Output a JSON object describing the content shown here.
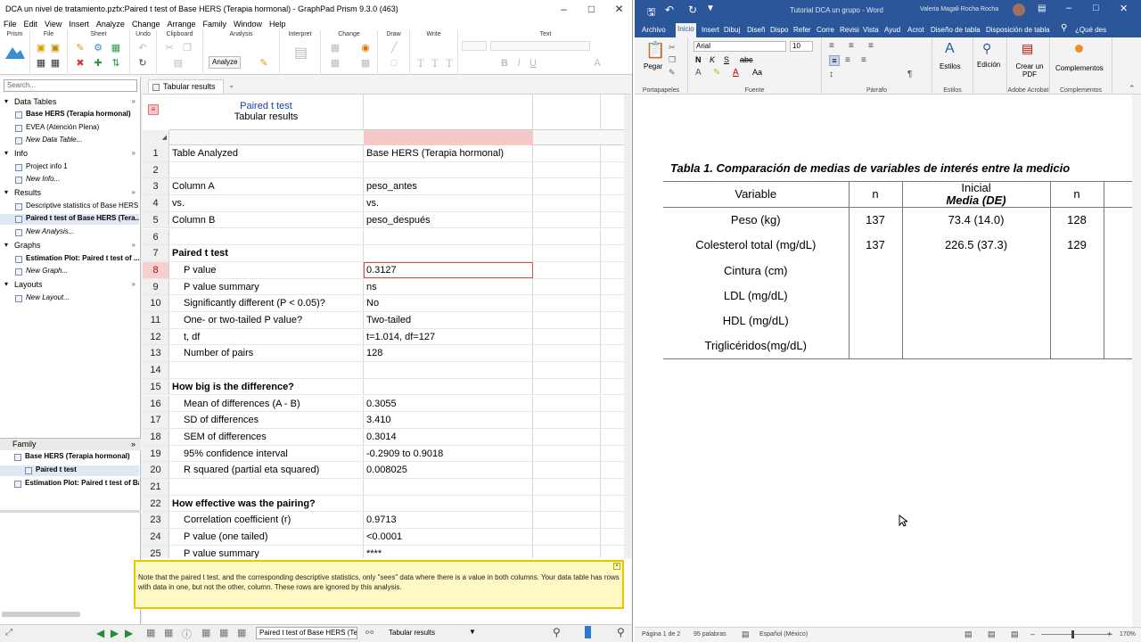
{
  "prism": {
    "window_title": "DCA un nivel de tratamiento.pzfx:Paired t test of Base HERS (Terapia hormonal) - GraphPad Prism 9.3.0 (463)",
    "menu": [
      "File",
      "Edit",
      "View",
      "Insert",
      "Analyze",
      "Change",
      "Arrange",
      "Family",
      "Window",
      "Help"
    ],
    "ribbon_groups": [
      "Prism",
      "File",
      "Sheet",
      "Undo",
      "Clipboard",
      "Analysis",
      "Interpret",
      "Change",
      "Draw",
      "Write",
      "Text"
    ],
    "analyze_button": "Analyze",
    "search_placeholder": "Search...",
    "navigator": {
      "data_tables": {
        "label": "Data Tables",
        "items": [
          "Base HERS (Terapia hormonal)",
          "EVEA (Atención Plena)",
          "New Data Table..."
        ]
      },
      "info": {
        "label": "Info",
        "items": [
          "Project info 1",
          "New Info..."
        ]
      },
      "results": {
        "label": "Results",
        "items": [
          "Descriptive statistics of Base HERS ...",
          "Paired t test of Base HERS (Tera...",
          "New Analysis..."
        ]
      },
      "graphs": {
        "label": "Graphs",
        "items": [
          "Estimation Plot: Paired t test of ...",
          "New Graph..."
        ]
      },
      "layouts": {
        "label": "Layouts",
        "items": [
          "New Layout..."
        ]
      }
    },
    "family": {
      "label": "Family",
      "items": [
        "Base HERS (Terapia hormonal)",
        "Paired t test",
        "Estimation Plot: Paired t test of Ba"
      ]
    },
    "sheet_tab": "Tabular results",
    "sheet_header_title": "Paired t test",
    "sheet_header_subtitle": "Tabular results",
    "rows": [
      {
        "n": "1",
        "label": "Table Analyzed",
        "value": "Base HERS (Terapia hormonal)",
        "style": ""
      },
      {
        "n": "2",
        "label": "",
        "value": "",
        "style": ""
      },
      {
        "n": "3",
        "label": "Column A",
        "value": "peso_antes",
        "style": ""
      },
      {
        "n": "4",
        "label": "vs.",
        "value": "vs.",
        "style": ""
      },
      {
        "n": "5",
        "label": "Column B",
        "value": "peso_después",
        "style": ""
      },
      {
        "n": "6",
        "label": "",
        "value": "",
        "style": ""
      },
      {
        "n": "7",
        "label": "Paired t test",
        "value": "",
        "style": "hd"
      },
      {
        "n": "8",
        "label": "P value",
        "value": "0.3127",
        "style": "ind"
      },
      {
        "n": "9",
        "label": "P value summary",
        "value": "ns",
        "style": "ind"
      },
      {
        "n": "10",
        "label": "Significantly different (P < 0.05)?",
        "value": "No",
        "style": "ind"
      },
      {
        "n": "11",
        "label": "One- or two-tailed P value?",
        "value": "Two-tailed",
        "style": "ind"
      },
      {
        "n": "12",
        "label": "t, df",
        "value": "t=1.014, df=127",
        "style": "ind"
      },
      {
        "n": "13",
        "label": "Number of pairs",
        "value": "128",
        "style": "ind"
      },
      {
        "n": "14",
        "label": "",
        "value": "",
        "style": ""
      },
      {
        "n": "15",
        "label": "How big is the difference?",
        "value": "",
        "style": "hd"
      },
      {
        "n": "16",
        "label": "Mean of differences (A - B)",
        "value": "0.3055",
        "style": "ind"
      },
      {
        "n": "17",
        "label": "SD of differences",
        "value": "3.410",
        "style": "ind"
      },
      {
        "n": "18",
        "label": "SEM of differences",
        "value": "0.3014",
        "style": "ind"
      },
      {
        "n": "19",
        "label": "95% confidence interval",
        "value": "-0.2909 to 0.9018",
        "style": "ind"
      },
      {
        "n": "20",
        "label": "R squared (partial eta squared)",
        "value": "0.008025",
        "style": "ind"
      },
      {
        "n": "21",
        "label": "",
        "value": "",
        "style": ""
      },
      {
        "n": "22",
        "label": "How effective was the pairing?",
        "value": "",
        "style": "hd"
      },
      {
        "n": "23",
        "label": "Correlation coefficient (r)",
        "value": "0.9713",
        "style": "ind"
      },
      {
        "n": "24",
        "label": "P value (one tailed)",
        "value": "<0.0001",
        "style": "ind"
      },
      {
        "n": "25",
        "label": "P value summary",
        "value": "****",
        "style": "ind"
      }
    ],
    "note": "Note that the paired t test, and the corresponding descriptive statistics, only \"sees\" data where there is a value in both columns. Your data table has rows with data in one, but not the other, column. These rows are ignored by this analysis.",
    "status_sheet": "Paired t test of Base HERS (Ter",
    "status_view": "Tabular results"
  },
  "word": {
    "title": "Tutorial DCA un grupo  -  Word",
    "user": "Valeria Magali Rocha Rocha",
    "tabs": [
      "Archivo",
      "Inicio",
      "Insert",
      "Dibuj",
      "Diseñ",
      "Dispo",
      "Refer",
      "Corre",
      "Revisi",
      "Vista",
      "Ayud",
      "Acrot",
      "Diseño de tabla",
      "Disposición de tabla"
    ],
    "tell_me": "¿Qué des",
    "font_name": "Arial",
    "font_size": "10",
    "groups": [
      "Portapapeles",
      "Fuente",
      "Párrafo",
      "Estilos",
      "Adobe Acrobat",
      "Complementos"
    ],
    "buttons": {
      "paste": "Pegar",
      "styles": "Estilos",
      "editing": "Edición",
      "create_pdf": "Crear un PDF",
      "addins": "Complementos"
    },
    "caption": "Tabla 1. Comparación de medias de variables de interés entre la medicio",
    "table": {
      "h_variable": "Variable",
      "h_n": "n",
      "h_inicial": "Inicial",
      "h_media": "Media (DE)",
      "h_n2": "n",
      "rows": [
        [
          "Peso (kg)",
          "137",
          "73.4 (14.0)",
          "128",
          ""
        ],
        [
          "Colesterol total (mg/dL)",
          "137",
          "226.5 (37.3)",
          "129",
          ""
        ],
        [
          "Cintura (cm)",
          "",
          "",
          "",
          ""
        ],
        [
          "LDL (mg/dL)",
          "",
          "",
          "",
          ""
        ],
        [
          "HDL (mg/dL)",
          "",
          "",
          "",
          ""
        ],
        [
          "Triglicéridos(mg/dL)",
          "",
          "",
          "",
          ""
        ]
      ]
    },
    "status": {
      "page": "Página 1 de 2",
      "words": "95 palabras",
      "language": "Español (México)",
      "zoom": "170%"
    }
  }
}
